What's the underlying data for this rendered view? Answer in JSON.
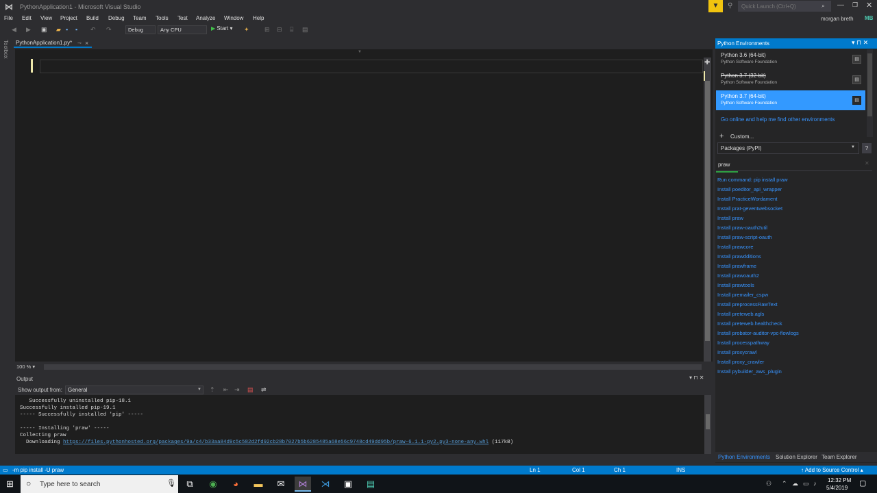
{
  "window": {
    "title": "PythonApplication1 - Microsoft Visual Studio",
    "quick_launch_placeholder": "Quick Launch (Ctrl+Q)",
    "user_name": "morgan breth",
    "user_initials": "MB"
  },
  "menu": [
    "File",
    "Edit",
    "View",
    "Project",
    "Build",
    "Debug",
    "Team",
    "Tools",
    "Test",
    "Analyze",
    "Window",
    "Help"
  ],
  "toolbar": {
    "config": "Debug",
    "platform": "Any CPU",
    "start_label": "Start"
  },
  "toolbox_label": "Toolbox",
  "editor": {
    "tab_label": "PythonApplication1.py*",
    "zoom": "100 %"
  },
  "output": {
    "title": "Output",
    "show_from_label": "Show output from:",
    "source": "General",
    "lines": [
      "   Successfully uninstalled pip-18.1",
      "Successfully installed pip-19.1",
      "----- Successfully installed 'pip' -----",
      "",
      "----- Installing 'praw' -----",
      "Collecting praw",
      "  Downloading "
    ],
    "download_url": "https://files.pythonhosted.org/packages/9a/c4/b33aa84d9c5c582d2fd92cb28b7027b5b6285485a68e56c9748cd49dd95b/praw-6.1.1-py2.py3-none-any.whl",
    "download_size": " (117kB)"
  },
  "python_envs": {
    "title": "Python Environments",
    "environments": [
      {
        "name": "Python 3.6 (64-bit)",
        "vendor": "Python Software Foundation"
      },
      {
        "name": "Python 3.7 (32-bit)",
        "vendor": "Python Software Foundation"
      },
      {
        "name": "Python 3.7 (64-bit)",
        "vendor": "Python Software Foundation"
      }
    ],
    "go_online": "Go online and help me find other environments",
    "custom": "Custom...",
    "packages_view": "Packages (PyPI)",
    "search_value": "praw",
    "results": [
      "Run command: pip install praw",
      "Install poeditor_api_wrapper",
      "Install PracticeWordament",
      "Install prat-geventwebsocket",
      "Install praw",
      "Install praw-oauth2util",
      "Install praw-script-oauth",
      "Install prawcore",
      "Install prawdditions",
      "Install prawframe",
      "Install prawoauth2",
      "Install prawtools",
      "Install premailer_cspw",
      "Install preprocessRawText",
      "Install preteweb.agls",
      "Install preteweb.healthcheck",
      "Install probator-auditor-vpc-flowlogs",
      "Install processpathway",
      "Install proxycrawl",
      "Install proxy_crawler",
      "Install pybuilder_aws_plugin"
    ],
    "tabs": [
      "Python Environments",
      "Solution Explorer",
      "Team Explorer"
    ]
  },
  "statusbar": {
    "message": "-m pip install -U praw",
    "ln": "Ln 1",
    "col": "Col 1",
    "ch": "Ch 1",
    "ins": "INS",
    "source_control": "Add to Source Control"
  },
  "taskbar": {
    "search_placeholder": "Type here to search",
    "time": "12:32 PM",
    "date": "5/4/2019"
  },
  "colors": {
    "accent": "#007acc",
    "selection": "#3399ff",
    "link": "#3794ff",
    "start_green": "#41c24a"
  }
}
